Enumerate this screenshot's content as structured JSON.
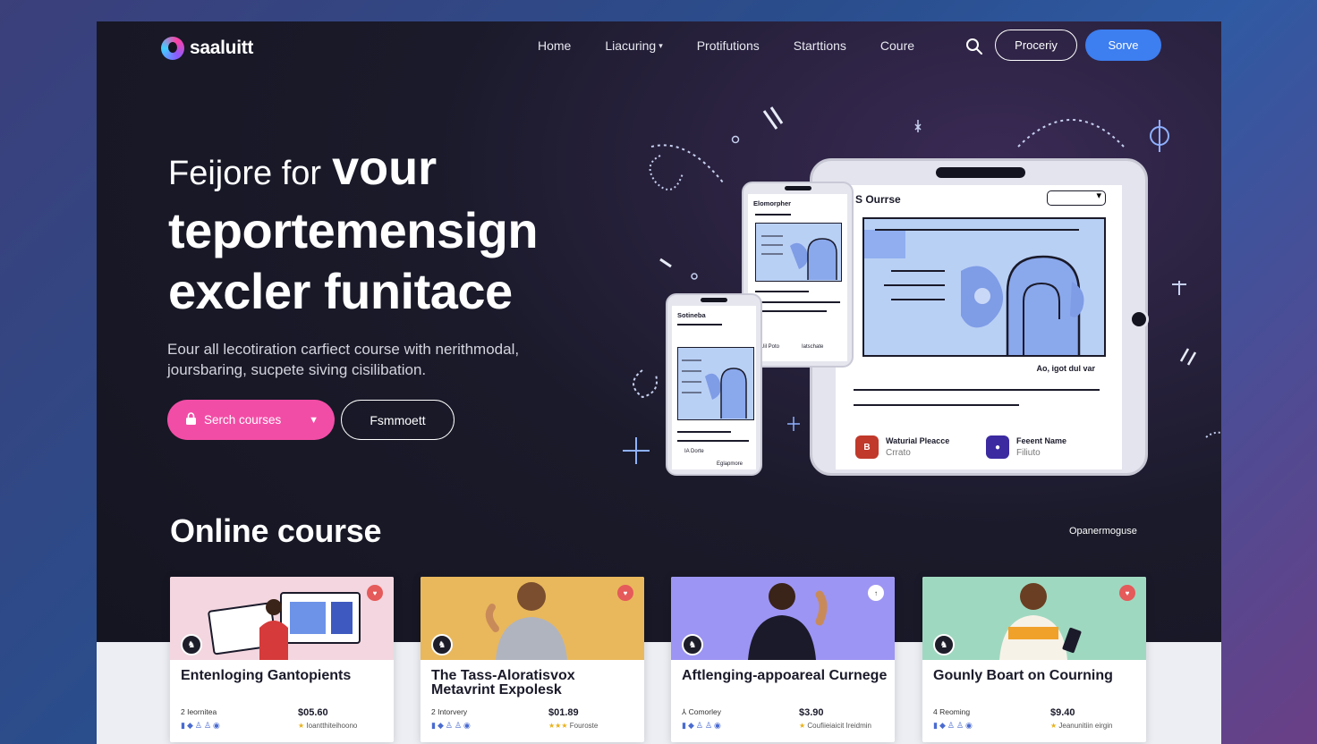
{
  "brand": {
    "name": "saaluitt"
  },
  "nav": {
    "items": [
      "Home",
      "Liacuring",
      "Protifutions",
      "Starttions",
      "Coure"
    ],
    "login_label": "Proceriy",
    "signup_label": "Sorve"
  },
  "hero": {
    "title_light": "Feijore for",
    "title_bold": "vour",
    "title_line2": "teportemensign",
    "title_line3": "excler funitace",
    "subtitle": "Eour all lecotiration carfiect course with nerithmodal, joursbaring, sucpete siving cisilibation.",
    "search_button": "Serch courses",
    "secondary_button": "Fsmmoett"
  },
  "mockup": {
    "tablet_title": "S Ourrse",
    "tablet_caption": "Ao, igot dul var",
    "user1_name": "Waturial Pleacce",
    "user1_role": "Crrato",
    "user2_name": "Feeent Name",
    "user2_role": "Filiuto",
    "phone_mid_title": "Elomorpher",
    "phone_mid_footer1": "Uil Poto",
    "phone_mid_footer2": "Iatschate",
    "phone_left_title": "Sotineba",
    "phone_left_footer1": "IA Dorte",
    "phone_left_footer2": "Eglapmore"
  },
  "section": {
    "title": "Online course",
    "link": "Opanermoguse"
  },
  "courses": [
    {
      "title": "Entenloging Gantopients",
      "meta": "2 Ieornitea",
      "price": "$05.60",
      "rating": "Ioantthiteihoono",
      "bg": "#f3d6df",
      "badge_color": "#e55a5a"
    },
    {
      "title": "The Tass-Aloratisvox Metavrint Expolesk",
      "meta": "2 Intorvery",
      "price": "$01.89",
      "rating": "Fouroste",
      "bg": "#e9b85c",
      "badge_color": "#e55a5a"
    },
    {
      "title": "Aftlenging-appoareal Curnege",
      "meta": "Comorley",
      "price": "$3.90",
      "rating": "Coufiieiaicit Ireidmin",
      "bg": "#9d95f3",
      "badge_color": "#ffffff"
    },
    {
      "title": "Gounly Boart on Courning",
      "meta": "4 Reoming",
      "price": "$9.40",
      "rating": "Jeanunitiin eirgin",
      "bg": "#9fd8c0",
      "badge_color": "#e55a5a"
    }
  ],
  "colors": {
    "accent_pink": "#f24da6",
    "accent_blue": "#3d7ef0"
  }
}
